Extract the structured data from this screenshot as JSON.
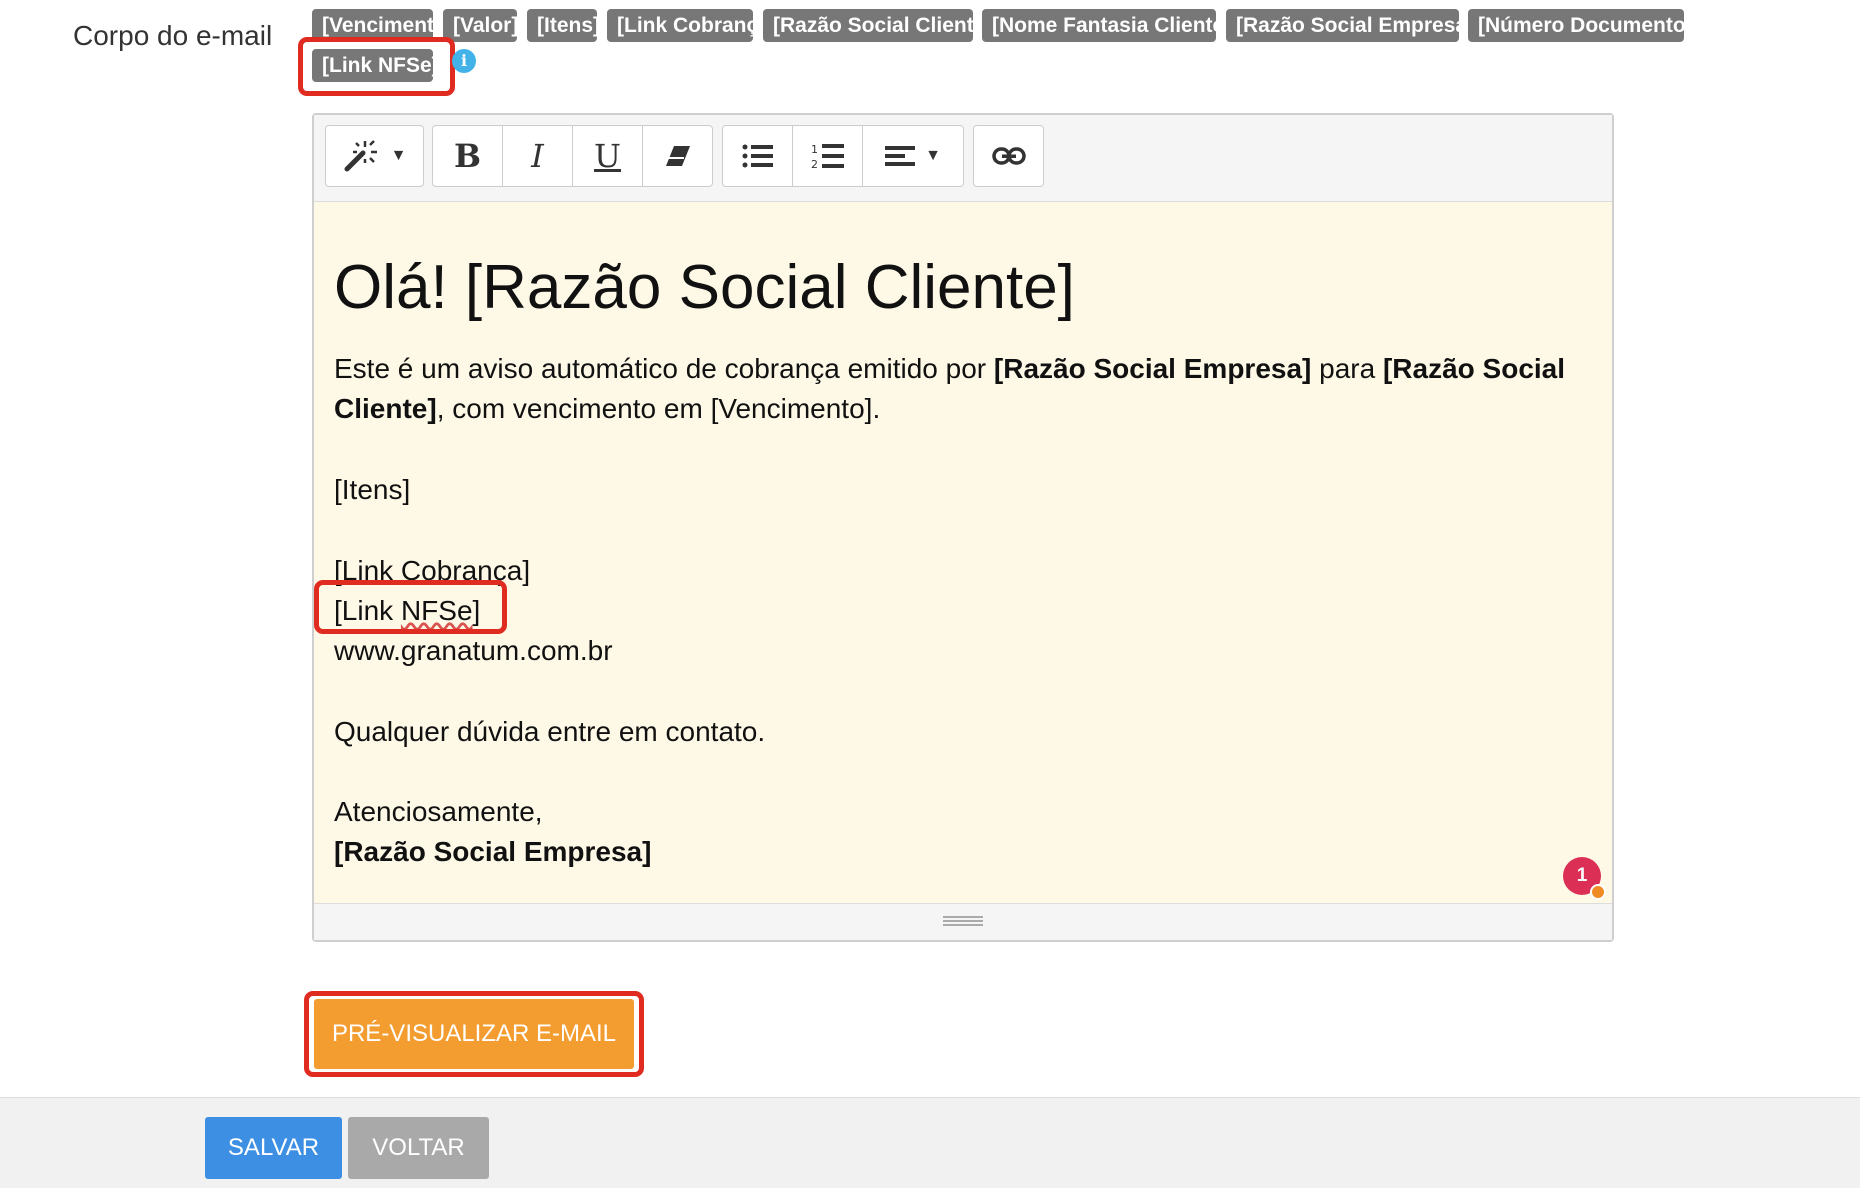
{
  "form": {
    "body_label": "Corpo do e-mail"
  },
  "tags": [
    "[Vencimento]",
    "[Valor]",
    "[Itens]",
    "[Link Cobrança]",
    "[Razão Social Cliente]",
    "[Nome Fantasia Cliente]",
    "[Razão Social Empresa]",
    "[Número Documento]",
    "[Link NFSe]"
  ],
  "info_icon_glyph": "i",
  "editor": {
    "heading": "Olá! [Razão Social Cliente]",
    "paragraph1_a": "Este é um aviso automático de cobrança emitido por ",
    "paragraph1_b": "[Razão Social Empresa]",
    "paragraph1_c": " para ",
    "paragraph1_d": "[Razão Social Cliente]",
    "paragraph1_e": ", com vencimento em [Vencimento].",
    "itens": "[Itens]",
    "link_cobranca": "[Link Cobrança]",
    "link_nfse_prefix": "[Link ",
    "link_nfse_word": "NFSe",
    "link_nfse_suffix": "]",
    "website": "www.granatum.com.br",
    "contact": "Qualquer dúvida entre em contato.",
    "closing": "Atenciosamente,",
    "signature": "[Razão Social Empresa]",
    "badge_count": "1"
  },
  "toolbar_icons": [
    "magic-wand-icon",
    "bold-icon",
    "italic-icon",
    "underline-icon",
    "eraser-icon",
    "unordered-list-icon",
    "ordered-list-icon",
    "align-icon",
    "link-icon"
  ],
  "buttons": {
    "preview": "PRÉ-VISUALIZAR E-MAIL",
    "save": "SALVAR",
    "back": "VOLTAR"
  },
  "colors": {
    "tag_bg": "#777777",
    "highlight": "#e02b20",
    "preview_button": "#f39c2f",
    "save_button": "#3c8fe3",
    "back_button": "#a9a9a9",
    "editor_bg": "#fef9e7",
    "info_icon": "#43b2e8",
    "badge": "#dc2f55"
  }
}
